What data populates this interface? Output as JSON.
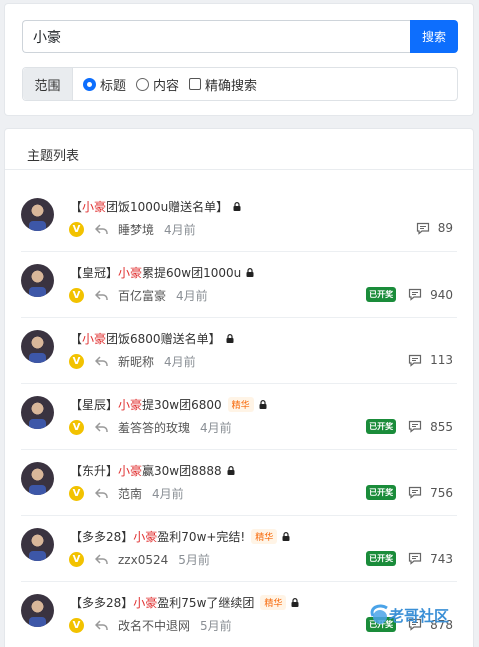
{
  "search": {
    "query": "小豪",
    "button": "搜索"
  },
  "scope": {
    "label": "范围",
    "options": [
      {
        "label": "标题",
        "type": "radio",
        "checked": true
      },
      {
        "label": "内容",
        "type": "radio",
        "checked": false
      },
      {
        "label": "精确搜索",
        "type": "checkbox",
        "checked": false
      }
    ]
  },
  "list": {
    "header": "主题列表",
    "items": [
      {
        "pre": "【",
        "hl": "小豪",
        "post": "团饭1000u赠送名单】",
        "essence": "",
        "author": "睡梦境",
        "time": "4月前",
        "opened": "",
        "comments": "89"
      },
      {
        "pre": "【皇冠】",
        "hl": "小豪",
        "post": "累提60w团1000u",
        "essence": "",
        "author": "百亿富豪",
        "time": "4月前",
        "opened": "已开奖",
        "comments": "940"
      },
      {
        "pre": "【",
        "hl": "小豪",
        "post": "团饭6800赠送名单】",
        "essence": "",
        "author": "新昵称",
        "time": "4月前",
        "opened": "",
        "comments": "113"
      },
      {
        "pre": "【星辰】",
        "hl": "小豪",
        "post": "提30w团6800",
        "essence": "精华",
        "author": "羞答答的玫瑰",
        "time": "4月前",
        "opened": "已开奖",
        "comments": "855"
      },
      {
        "pre": "【东升】",
        "hl": "小豪",
        "post": "赢30w团8888",
        "essence": "",
        "author": "范南",
        "time": "4月前",
        "opened": "已开奖",
        "comments": "756"
      },
      {
        "pre": "【多多28】",
        "hl": "小豪",
        "post": "盈利70w+完结!",
        "essence": "精华",
        "author": "zzx0524",
        "time": "5月前",
        "opened": "已开奖",
        "comments": "743"
      },
      {
        "pre": "【多多28】",
        "hl": "小豪",
        "post": "盈利75w了继续团",
        "essence": "精华",
        "author": "改名不中退网",
        "time": "5月前",
        "opened": "已开奖",
        "comments": "878"
      }
    ]
  },
  "badge_letter": "V",
  "watermark": "老哥社区",
  "colors": {
    "accent": "#0d6efd",
    "highlight": "#e03131",
    "opened": "#1a8c3a",
    "vip": "#f2c200"
  },
  "icons": {
    "lock": "lock-icon",
    "reply": "reply-icon",
    "comment": "comment-icon"
  }
}
